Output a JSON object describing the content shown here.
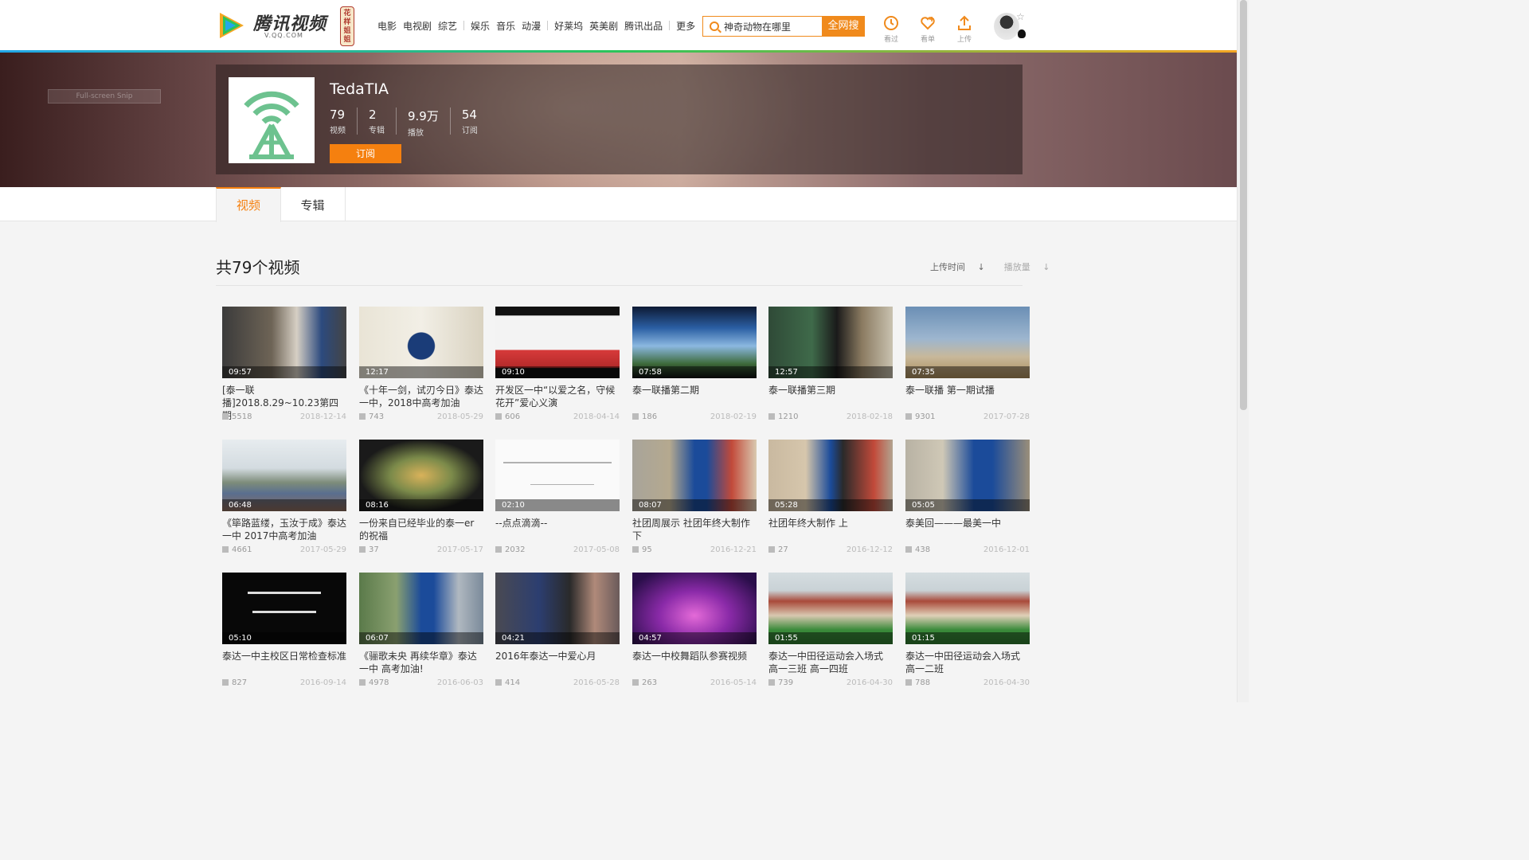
{
  "header": {
    "logo_text": "腾讯视频",
    "logo_sub": "V.QQ.COM",
    "badge_text": "花样姐姐",
    "nav": [
      "电影",
      "电视剧",
      "综艺",
      "娱乐",
      "音乐",
      "动漫",
      "好莱坞",
      "英美剧",
      "腾讯出品",
      "更多"
    ],
    "search_value": "神奇动物在哪里",
    "search_button": "全网搜",
    "tools": [
      {
        "label": "看过",
        "icon": "history-icon"
      },
      {
        "label": "看单",
        "icon": "heart-plus-icon"
      },
      {
        "label": "上传",
        "icon": "upload-icon"
      }
    ]
  },
  "overlay": {
    "snip_label": "Full-screen Snip"
  },
  "channel": {
    "name": "TedaTIA",
    "stats": [
      {
        "num": "79",
        "label": "视频"
      },
      {
        "num": "2",
        "label": "专辑"
      },
      {
        "num": "9.9万",
        "label": "播放"
      },
      {
        "num": "54",
        "label": "订阅"
      }
    ],
    "subscribe_label": "订阅"
  },
  "tabs": [
    "视频",
    "专辑"
  ],
  "section": {
    "title": "共79个视频",
    "sort_upload": "上传时间",
    "sort_plays": "播放量"
  },
  "videos": [
    {
      "duration": "09:57",
      "title": "[泰一联播]2018.8.29~10.23第四期",
      "plays": "5518",
      "date": "2018-12-14"
    },
    {
      "duration": "12:17",
      "title": "《十年一剑，试刃今日》泰达一中，2018中高考加油",
      "plays": "743",
      "date": "2018-05-29"
    },
    {
      "duration": "09:10",
      "title": "开发区一中“以爱之名，守候花开”爱心义演",
      "plays": "606",
      "date": "2018-04-14"
    },
    {
      "duration": "07:58",
      "title": "泰一联播第二期",
      "plays": "186",
      "date": "2018-02-19"
    },
    {
      "duration": "12:57",
      "title": "泰一联播第三期",
      "plays": "1210",
      "date": "2018-02-18"
    },
    {
      "duration": "07:35",
      "title": "泰一联播 第一期试播",
      "plays": "9301",
      "date": "2017-07-28"
    },
    {
      "duration": "06:48",
      "title": "《筚路蓝缕，玉汝于成》泰达一中 2017中高考加油",
      "plays": "4661",
      "date": "2017-05-29"
    },
    {
      "duration": "08:16",
      "title": "一份来自已经毕业的泰一er的祝福",
      "plays": "37",
      "date": "2017-05-17"
    },
    {
      "duration": "02:10",
      "title": "--点点滴滴--",
      "plays": "2032",
      "date": "2017-05-08"
    },
    {
      "duration": "08:07",
      "title": "社团周展示 社团年终大制作 下",
      "plays": "95",
      "date": "2016-12-21"
    },
    {
      "duration": "05:28",
      "title": "社团年终大制作 上",
      "plays": "27",
      "date": "2016-12-12"
    },
    {
      "duration": "05:05",
      "title": "泰美回———最美一中",
      "plays": "438",
      "date": "2016-12-01"
    },
    {
      "duration": "05:10",
      "title": "泰达一中主校区日常检查标准",
      "plays": "827",
      "date": "2016-09-14"
    },
    {
      "duration": "06:07",
      "title": "《骊歌未央 再续华章》泰达一中 高考加油!",
      "plays": "4978",
      "date": "2016-06-03"
    },
    {
      "duration": "04:21",
      "title": "2016年泰达一中爱心月",
      "plays": "414",
      "date": "2016-05-28"
    },
    {
      "duration": "04:57",
      "title": "泰达一中校舞蹈队参赛视频",
      "plays": "263",
      "date": "2016-05-14"
    },
    {
      "duration": "01:55",
      "title": "泰达一中田径运动会入场式 高一三班 高一四班",
      "plays": "739",
      "date": "2016-04-30"
    },
    {
      "duration": "01:15",
      "title": "泰达一中田径运动会入场式 高一二班",
      "plays": "788",
      "date": "2016-04-30"
    }
  ],
  "colors": {
    "accent": "#f5800f",
    "search_border": "#f08a1c"
  }
}
